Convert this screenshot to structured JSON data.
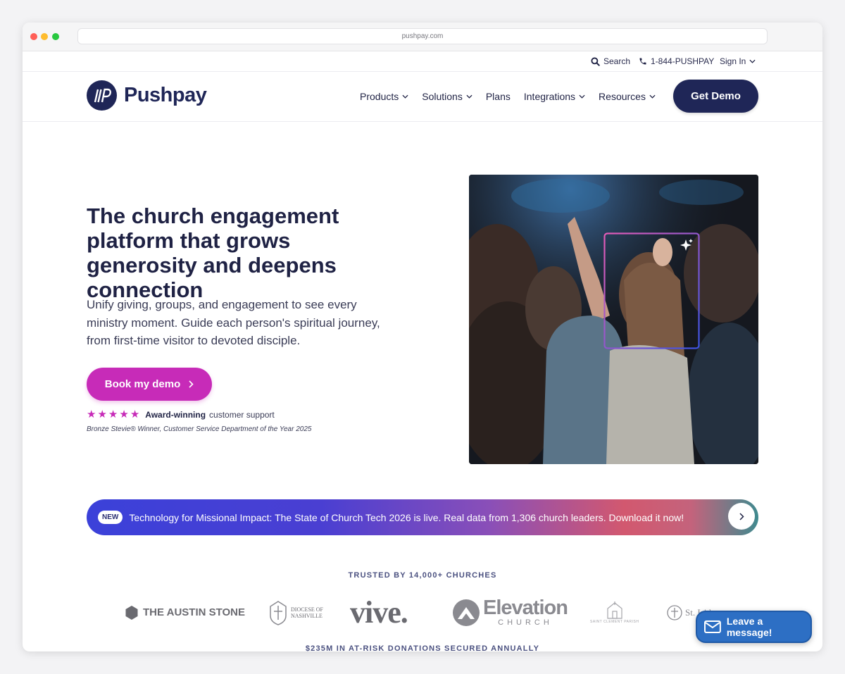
{
  "browser": {
    "url": "pushpay.com"
  },
  "utility": {
    "search_label": "Search",
    "phone": "1-844-PUSHPAY",
    "signin_label": "Sign In"
  },
  "brand": {
    "name": "Pushpay",
    "mark": "//P",
    "color": "#1f2657"
  },
  "nav": {
    "items": [
      {
        "label": "Products",
        "has_dropdown": true
      },
      {
        "label": "Solutions",
        "has_dropdown": true
      },
      {
        "label": "Plans",
        "has_dropdown": false
      },
      {
        "label": "Integrations",
        "has_dropdown": true
      },
      {
        "label": "Resources",
        "has_dropdown": true
      }
    ],
    "cta_label": "Get Demo"
  },
  "hero": {
    "title": "The church engagement platform that grows generosity and deepens connection",
    "subtitle": "Unify giving, groups, and engagement to see every ministry moment. Guide each person's spiritual journey, from first-time visitor to devoted disciple.",
    "cta_label": "Book my demo",
    "rating_stars": 5,
    "award_bold": "Award-winning",
    "award_rest": "customer support",
    "award_note": "Bronze Stevie® Winner, Customer Service Department of the Year 2025",
    "accent_color": "#c72bb8"
  },
  "banner": {
    "badge": "NEW",
    "text": "Technology for Missional Impact: The State of Church Tech 2026 is live. Real data from 1,306 church leaders. Download it now!"
  },
  "trusted": {
    "heading": "TRUSTED BY 14,000+ CHURCHES",
    "logos": [
      "THE AUSTIN STONE",
      "DIOCESE OF NASHVILLE",
      "vive.",
      "Elevation",
      "CHURCH",
      "SAINT CLEMENT PARISH",
      "St. Isidore"
    ]
  },
  "stats": {
    "donations": "$235M IN AT-RISK DONATIONS SECURED ANNUALLY"
  },
  "chat": {
    "label": "Leave a message!"
  },
  "icons": {
    "search": "search-icon",
    "phone": "phone-icon",
    "chevron": "chevron-down-icon",
    "sparkle": "sparkle-icon",
    "mail": "mail-icon"
  }
}
